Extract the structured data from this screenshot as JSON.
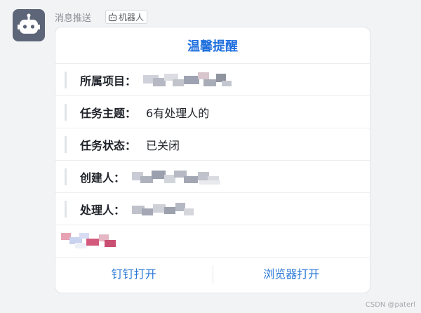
{
  "sender": {
    "name": "消息推送",
    "tag_label": "机器人",
    "avatar_icon": "robot-icon",
    "tag_icon": "robot-icon"
  },
  "card": {
    "title": "温馨提醒",
    "fields": [
      {
        "label": "所属项目：",
        "value": ""
      },
      {
        "label": "任务主题：",
        "value": "6有处理人的"
      },
      {
        "label": "任务状态：",
        "value": "已关闭"
      },
      {
        "label": "创建人：",
        "value": ""
      },
      {
        "label": "处理人：",
        "value": ""
      }
    ],
    "actions": [
      {
        "label": "钉钉打开"
      },
      {
        "label": "浏览器打开"
      }
    ]
  },
  "colors": {
    "accent": "#1f6fde",
    "link": "#2b78d8",
    "avatar_bg": "#5d6678",
    "page_bg": "#f2f3f5"
  },
  "watermark": "CSDN @paterl"
}
